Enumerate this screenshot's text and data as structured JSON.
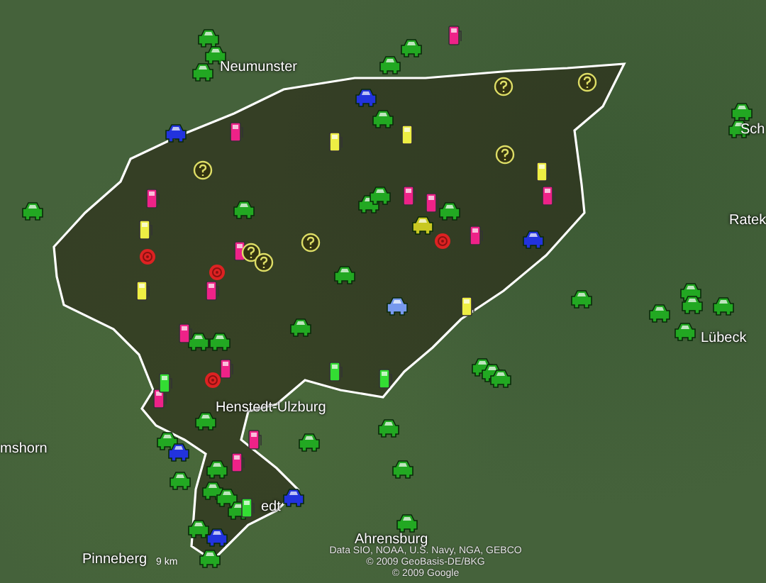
{
  "map": {
    "place_labels": [
      {
        "text": "Neumunster"
      },
      {
        "text": "Henstedt-Ulzburg"
      },
      {
        "text": "Sch"
      },
      {
        "text": "Ratek"
      },
      {
        "text": "Lübeck"
      },
      {
        "text": "mshorn"
      },
      {
        "text": "Pinneberg"
      },
      {
        "text": "Ahrensburg"
      },
      {
        "text": "edt"
      }
    ],
    "scale": "9 km",
    "attribution": [
      "Data SIO, NOAA, U.S. Navy, NGA, GEBCO",
      "© 2009 GeoBasis-DE/BKG",
      "© 2009 Google"
    ],
    "markers": [
      {
        "kind": "car",
        "color": "#22a822"
      },
      {
        "kind": "car",
        "color": "#22a822"
      },
      {
        "kind": "car",
        "color": "#22a822"
      },
      {
        "kind": "car",
        "color": "#22a822"
      },
      {
        "kind": "car",
        "color": "#22a822"
      },
      {
        "kind": "car",
        "color": "#22a822"
      },
      {
        "kind": "car",
        "color": "#22a822"
      },
      {
        "kind": "car",
        "color": "#22a822"
      },
      {
        "kind": "car",
        "color": "#22a822"
      },
      {
        "kind": "car",
        "color": "#22a822"
      },
      {
        "kind": "car",
        "color": "#22a822"
      },
      {
        "kind": "car",
        "color": "#22a822"
      },
      {
        "kind": "car",
        "color": "#22a822"
      },
      {
        "kind": "car",
        "color": "#22a822"
      },
      {
        "kind": "car",
        "color": "#22a822"
      },
      {
        "kind": "car",
        "color": "#22a822"
      },
      {
        "kind": "car",
        "color": "#22a822"
      },
      {
        "kind": "car",
        "color": "#22a822"
      },
      {
        "kind": "car",
        "color": "#22a822"
      },
      {
        "kind": "car",
        "color": "#22a822"
      },
      {
        "kind": "car",
        "color": "#22a822"
      },
      {
        "kind": "car",
        "color": "#22a822"
      },
      {
        "kind": "car",
        "color": "#22a822"
      },
      {
        "kind": "car",
        "color": "#22a822"
      },
      {
        "kind": "car",
        "color": "#22a822"
      },
      {
        "kind": "car",
        "color": "#22a822"
      },
      {
        "kind": "car",
        "color": "#22a822"
      },
      {
        "kind": "car",
        "color": "#22a822"
      },
      {
        "kind": "car",
        "color": "#22a822"
      },
      {
        "kind": "car",
        "color": "#22a822"
      },
      {
        "kind": "car",
        "color": "#22a822"
      },
      {
        "kind": "car",
        "color": "#22a822"
      },
      {
        "kind": "car",
        "color": "#22a822"
      },
      {
        "kind": "car",
        "color": "#22a822"
      },
      {
        "kind": "car",
        "color": "#22a822"
      },
      {
        "kind": "car",
        "color": "#22a822"
      },
      {
        "kind": "car",
        "color": "#22a822"
      },
      {
        "kind": "car",
        "color": "#22a822"
      },
      {
        "kind": "car",
        "color": "#22a822"
      },
      {
        "kind": "car",
        "color": "#c8c822"
      },
      {
        "kind": "car",
        "color": "#2233dd"
      },
      {
        "kind": "car",
        "color": "#2233dd"
      },
      {
        "kind": "car",
        "color": "#2233dd"
      },
      {
        "kind": "car",
        "color": "#2233dd"
      },
      {
        "kind": "car",
        "color": "#2233dd"
      },
      {
        "kind": "car",
        "color": "#2233dd"
      },
      {
        "kind": "car",
        "color": "#7799ee"
      },
      {
        "kind": "fuel",
        "color": "#ee2288"
      },
      {
        "kind": "fuel",
        "color": "#ee2288"
      },
      {
        "kind": "fuel",
        "color": "#ee2288"
      },
      {
        "kind": "fuel",
        "color": "#ee2288"
      },
      {
        "kind": "fuel",
        "color": "#ee2288"
      },
      {
        "kind": "fuel",
        "color": "#ee2288"
      },
      {
        "kind": "fuel",
        "color": "#ee2288"
      },
      {
        "kind": "fuel",
        "color": "#ee2288"
      },
      {
        "kind": "fuel",
        "color": "#ee2288"
      },
      {
        "kind": "fuel",
        "color": "#ee2288"
      },
      {
        "kind": "fuel",
        "color": "#ee2288"
      },
      {
        "kind": "fuel",
        "color": "#ee2288"
      },
      {
        "kind": "fuel",
        "color": "#ee2288"
      },
      {
        "kind": "fuel",
        "color": "#ee2288"
      },
      {
        "kind": "fuel",
        "color": "#eeee44"
      },
      {
        "kind": "fuel",
        "color": "#eeee44"
      },
      {
        "kind": "fuel",
        "color": "#eeee44"
      },
      {
        "kind": "fuel",
        "color": "#eeee44"
      },
      {
        "kind": "fuel",
        "color": "#eeee44"
      },
      {
        "kind": "fuel",
        "color": "#eeee44"
      },
      {
        "kind": "fuel",
        "color": "#33dd33"
      },
      {
        "kind": "fuel",
        "color": "#33dd33"
      },
      {
        "kind": "fuel",
        "color": "#33dd33"
      },
      {
        "kind": "fuel",
        "color": "#33dd33"
      },
      {
        "kind": "question",
        "color": "#dddd66"
      },
      {
        "kind": "question",
        "color": "#dddd66"
      },
      {
        "kind": "question",
        "color": "#dddd66"
      },
      {
        "kind": "question",
        "color": "#dddd66"
      },
      {
        "kind": "question",
        "color": "#dddd66"
      },
      {
        "kind": "question",
        "color": "#dddd66"
      },
      {
        "kind": "question",
        "color": "#dddd66"
      },
      {
        "kind": "target",
        "color": "#dd2222"
      },
      {
        "kind": "target",
        "color": "#dd2222"
      },
      {
        "kind": "target",
        "color": "#dd2222"
      },
      {
        "kind": "target",
        "color": "#dd2222"
      }
    ]
  }
}
